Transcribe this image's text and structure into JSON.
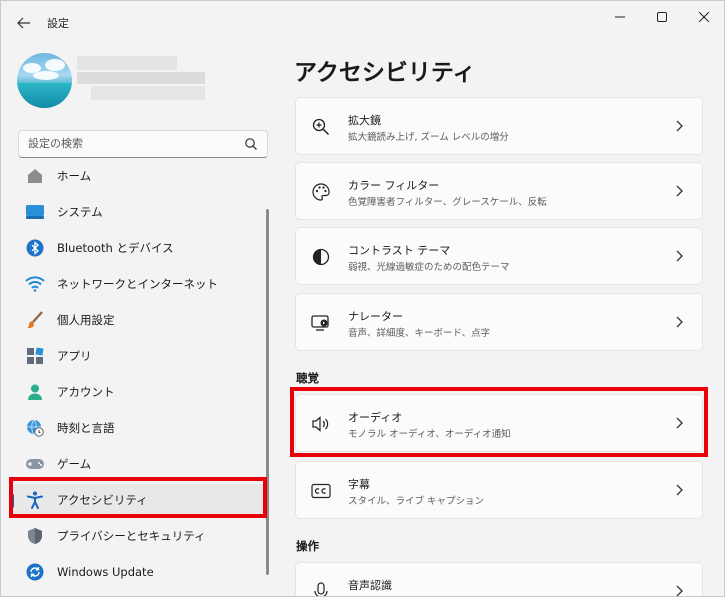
{
  "window": {
    "title": "設定",
    "controls": {
      "minimize": "minimize-icon",
      "maximize": "maximize-icon",
      "close": "close-icon"
    }
  },
  "sidebar": {
    "search_placeholder": "設定の検索",
    "items": [
      {
        "label": "ホーム",
        "icon": "home-icon"
      },
      {
        "label": "システム",
        "icon": "system-icon"
      },
      {
        "label": "Bluetooth とデバイス",
        "icon": "bluetooth-icon"
      },
      {
        "label": "ネットワークとインターネット",
        "icon": "wifi-icon"
      },
      {
        "label": "個人用設定",
        "icon": "brush-icon"
      },
      {
        "label": "アプリ",
        "icon": "apps-icon"
      },
      {
        "label": "アカウント",
        "icon": "account-icon"
      },
      {
        "label": "時刻と言語",
        "icon": "globe-clock-icon"
      },
      {
        "label": "ゲーム",
        "icon": "gamepad-icon"
      },
      {
        "label": "アクセシビリティ",
        "icon": "accessibility-icon",
        "active": true
      },
      {
        "label": "プライバシーとセキュリティ",
        "icon": "shield-icon"
      },
      {
        "label": "Windows Update",
        "icon": "update-icon"
      }
    ]
  },
  "main": {
    "title": "アクセシビリティ",
    "vision_cards": [
      {
        "title": "拡大鏡",
        "subtitle": "拡大鏡読み上げ, ズーム レベルの増分",
        "icon": "magnifier-icon"
      },
      {
        "title": "カラー フィルター",
        "subtitle": "色覚障害者フィルター、グレースケール、反転",
        "icon": "palette-icon"
      },
      {
        "title": "コントラスト テーマ",
        "subtitle": "弱視、光線過敏症のための配色テーマ",
        "icon": "contrast-icon"
      },
      {
        "title": "ナレーター",
        "subtitle": "音声、詳細度、キーボード、点字",
        "icon": "narrator-icon"
      }
    ],
    "hearing_heading": "聴覚",
    "hearing_cards": [
      {
        "title": "オーディオ",
        "subtitle": "モノラル オーディオ、オーディオ通知",
        "icon": "speaker-icon"
      },
      {
        "title": "字幕",
        "subtitle": "スタイル、ライブ キャプション",
        "icon": "captions-icon"
      }
    ],
    "interaction_heading": "操作",
    "interaction_cards": [
      {
        "title": "音声認識",
        "subtitle": "",
        "icon": "microphone-icon"
      }
    ]
  },
  "colors": {
    "highlight_red": "#e8000b",
    "accent_blue": "#0067c0"
  }
}
